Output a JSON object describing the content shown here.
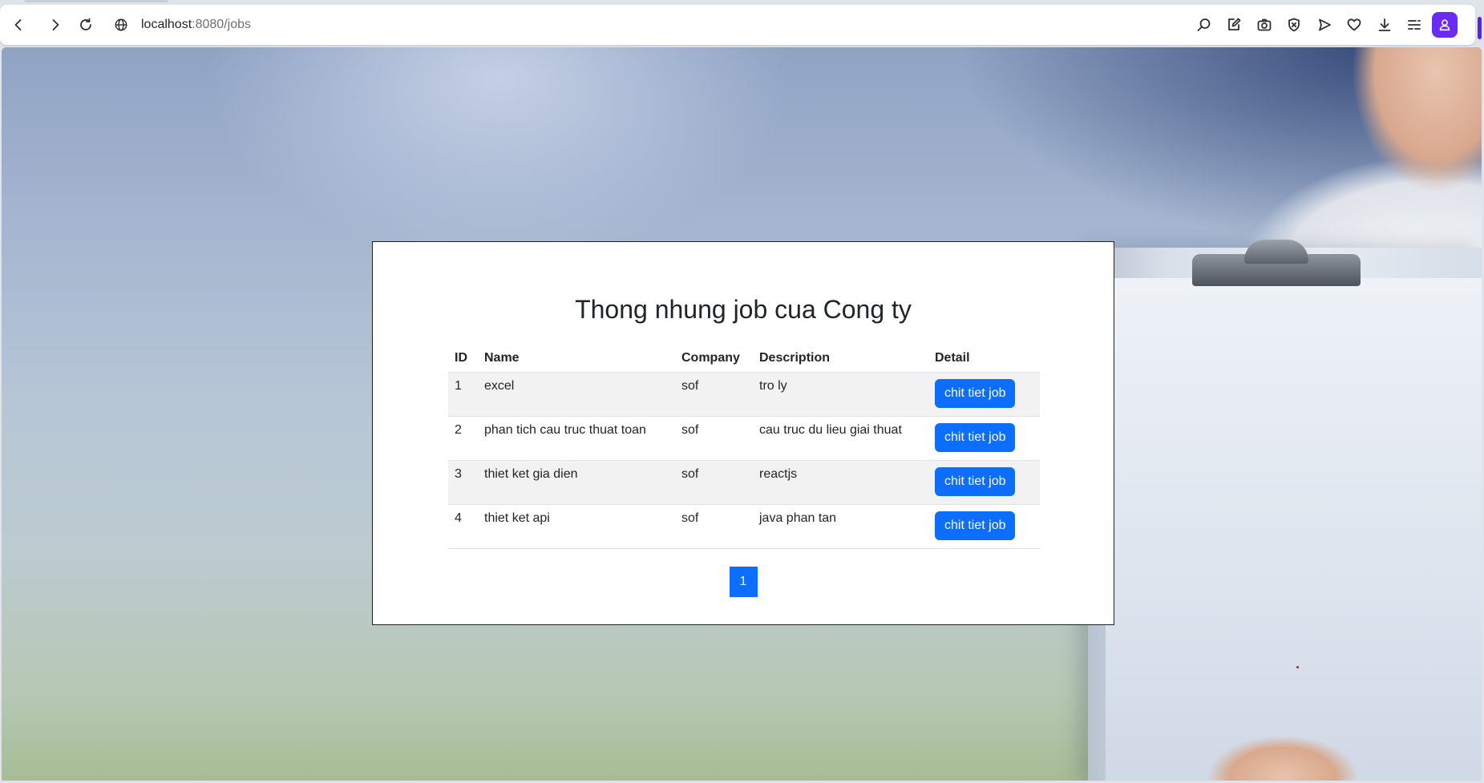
{
  "browser": {
    "url_host": "localhost",
    "url_path": ":8080/jobs",
    "icons": [
      "back-icon",
      "forward-icon",
      "reload-icon",
      "site-info-icon",
      "search-page-icon",
      "edit-icon",
      "camera-icon",
      "shield-icon",
      "send-icon",
      "heart-icon",
      "download-icon",
      "menu-icon",
      "profile-icon"
    ]
  },
  "page": {
    "title": "Thong nhung job cua Cong ty",
    "table": {
      "headers": [
        "ID",
        "Name",
        "Company",
        "Description",
        "Detail"
      ],
      "rows": [
        {
          "id": "1",
          "name": "excel",
          "company": "sof",
          "description": "tro ly",
          "detail": "chit tiet job"
        },
        {
          "id": "2",
          "name": "phan tich cau truc thuat toan",
          "company": "sof",
          "description": "cau truc du lieu giai thuat",
          "detail": "chit tiet job"
        },
        {
          "id": "3",
          "name": "thiet ket gia dien",
          "company": "sof",
          "description": "reactjs",
          "detail": "chit tiet job"
        },
        {
          "id": "4",
          "name": "thiet ket api",
          "company": "sof",
          "description": "java phan tan",
          "detail": "chit tiet job"
        }
      ]
    },
    "pagination": {
      "current": "1"
    }
  },
  "colors": {
    "primary": "#0d6efd",
    "profile": "#6a2cf5"
  }
}
